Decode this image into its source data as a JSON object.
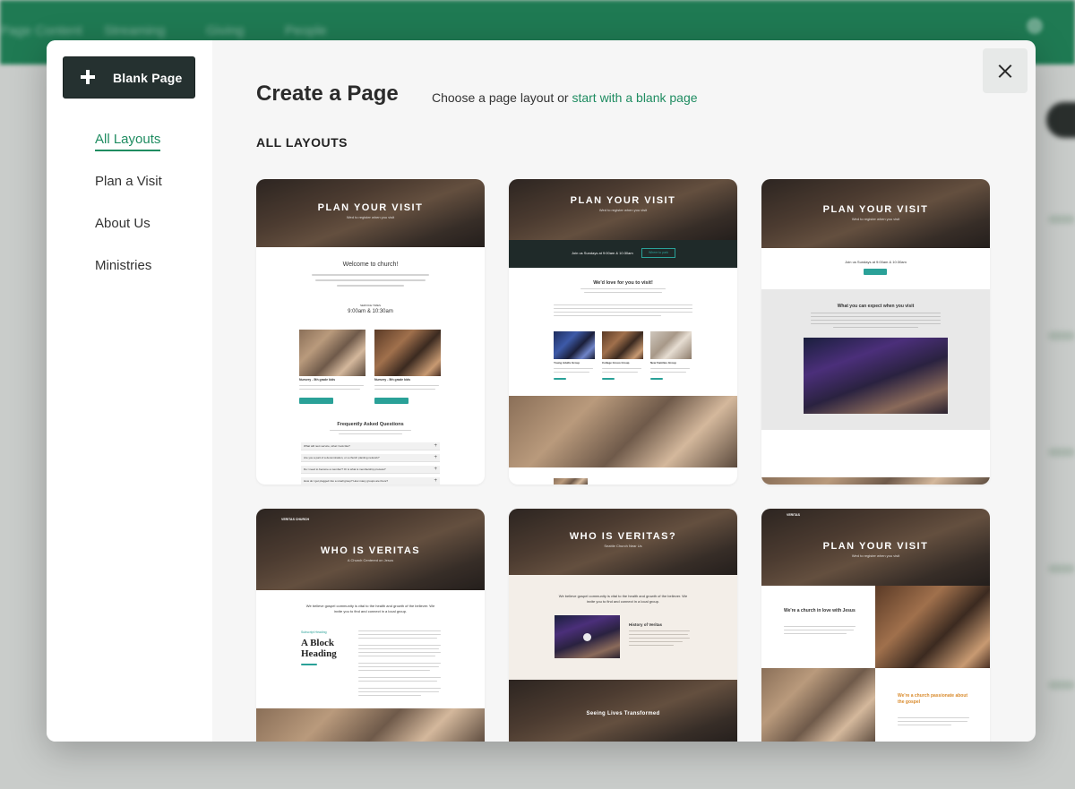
{
  "background": {
    "nav": [
      "Page Content",
      "Streaming",
      "Giving",
      "People"
    ]
  },
  "sidebar": {
    "blank_page_label": "Blank Page",
    "items": [
      {
        "label": "All Layouts",
        "active": true
      },
      {
        "label": "Plan a Visit",
        "active": false
      },
      {
        "label": "About Us",
        "active": false
      },
      {
        "label": "Ministries",
        "active": false
      }
    ]
  },
  "header": {
    "title": "Create a Page",
    "subtitle_prefix": "Choose a page layout or",
    "subtitle_link": "start with a blank page"
  },
  "section_title": "ALL LAYOUTS",
  "colors": {
    "accent": "#1f8c61",
    "dark_button": "#253130",
    "template_button": "#2aa198"
  },
  "layouts": [
    {
      "hero_title": "PLAN YOUR VISIT",
      "hero_sub": "Wed to register when you visit",
      "welcome": "Welcome to church!",
      "service_label": "SERVICE TIMES",
      "times": "9:00am  &  10:30am",
      "col1_title": "Nursery - 5th grade kids",
      "col2_title": "Nursery - 5th grade kids",
      "faq_title": "Frequently Asked Questions",
      "faqs": [
        "What will next service, what I look like?",
        "Are you a part of a denomination, or a church planting network?",
        "Do I need to become a member? Or is what is membership process?",
        "How do I get plugged into a small group? How many groups are there?"
      ]
    },
    {
      "hero_title": "PLAN YOUR VISIT",
      "hero_sub": "Wed to register when you visit",
      "bar_text": "Join us Sundays at 9:00am  &  10:30am",
      "bar_button": "Where to park",
      "love_title": "We'd love for you to visit!",
      "groups": [
        "Young Adults Group",
        "College Grouo Group",
        "New Families Group"
      ]
    },
    {
      "hero_title": "PLAN YOUR VISIT",
      "hero_sub": "Wed to register when you visit",
      "join_text": "Join us Sundays at 9:00am  &  10:30am",
      "expect_title": "What you can expect when you visit"
    },
    {
      "brand": "VERITAS CHURCH",
      "hero_title": "WHO IS VERITAS",
      "hero_sub": "A Church Centered on Jesus",
      "intro": "We believe gospel community is vital to the health and growth of the believer. We invite you to find and connect in a local group.",
      "block_label": "Subscript Heading",
      "block_heading": "A Block Heading"
    },
    {
      "hero_title": "WHO IS VERITAS?",
      "hero_sub": "Seattle Church Near Us",
      "intro": "We believe gospel community is vital to the health and growth of the believer. We invite you to find and connect in a local group.",
      "history_title": "History of Veritas",
      "bottom_title": "Seeing Lives Transformed"
    },
    {
      "brand": "VERITAS",
      "hero_title": "PLAN YOUR VISIT",
      "hero_sub": "Wed to register when you visit",
      "love_title": "We're a church in love with Jesus",
      "passion_title": "We're a church passionate about the gospel"
    }
  ]
}
